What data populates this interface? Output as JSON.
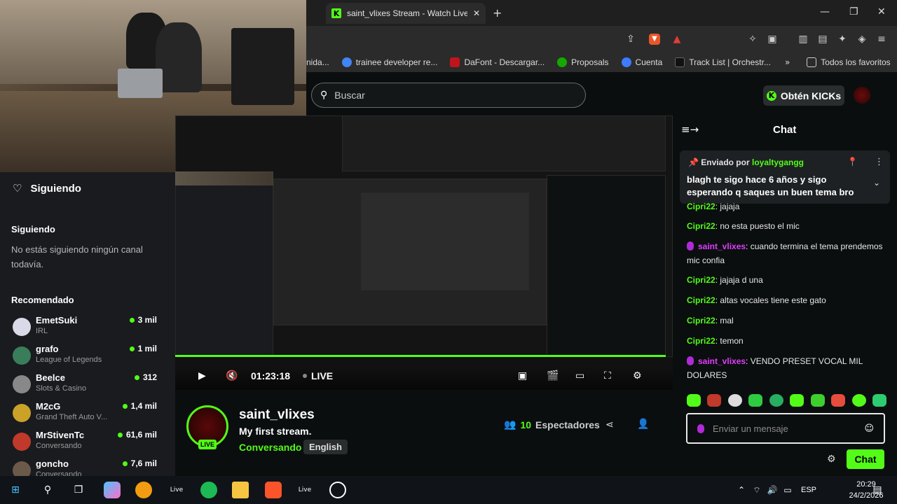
{
  "browser": {
    "tab_title": "saint_vlixes Stream - Watch Live",
    "bookmarks": [
      {
        "label": "nida...",
        "color": "#2b2b2b"
      },
      {
        "label": "trainee developer re...",
        "color": "#4285f4"
      },
      {
        "label": "DaFont - Descargar...",
        "color": "#c0141c"
      },
      {
        "label": "Proposals",
        "color": "#14a800"
      },
      {
        "label": "Cuenta",
        "color": "#3d7bff"
      },
      {
        "label": "Track List | Orchestr...",
        "color": "#111111"
      }
    ],
    "all_bookmarks": "Todos los favoritos"
  },
  "header": {
    "search_placeholder": "Buscar",
    "kicks_button": "Obtén KICKs"
  },
  "sidebar": {
    "following_title": "Siguiendo",
    "following_label": "Siguiendo",
    "empty_text": "No estás siguiendo ningún canal todavía.",
    "recommended_label": "Recomendado",
    "channels": [
      {
        "name": "EmetSuki",
        "category": "IRL",
        "viewers": "3 mil",
        "color": "#d9d9e8"
      },
      {
        "name": "grafo",
        "category": "League of Legends",
        "viewers": "1 mil",
        "color": "#3a7d5a"
      },
      {
        "name": "Beelce",
        "category": "Slots & Casino",
        "viewers": "312",
        "color": "#888888"
      },
      {
        "name": "M2cG",
        "category": "Grand Theft Auto V...",
        "viewers": "1,4 mil",
        "color": "#c9a227"
      },
      {
        "name": "MrStivenTc",
        "category": "Conversando",
        "viewers": "61,6 mil",
        "color": "#c0392b"
      },
      {
        "name": "goncho",
        "category": "Conversando",
        "viewers": "7,6 mil",
        "color": "#6b5a4a"
      }
    ]
  },
  "player": {
    "time": "01:23:18",
    "live_label": "LIVE"
  },
  "stream": {
    "streamer": "saint_vlixes",
    "title": "My first stream.",
    "category": "Conversando",
    "language": "English",
    "viewers": "10",
    "viewers_label": "Espectadores",
    "live_badge": "LIVE"
  },
  "chat": {
    "title": "Chat",
    "pinned_by_prefix": "Enviado por",
    "pinned_by_user": "loyaltygangg",
    "pinned_message": "blagh te sigo hace 6 años y sigo esperando q saques un buen tema bro",
    "messages": [
      {
        "user": "Cipri22",
        "text": "jajaja",
        "mod": false
      },
      {
        "user": "Cipri22",
        "text": "no esta puesto el mic",
        "mod": false
      },
      {
        "user": "saint_vlixes",
        "text": "cuando termina el tema prendemos mic confia",
        "mod": true
      },
      {
        "user": "Cipri22",
        "text": "jajaja d una",
        "mod": false
      },
      {
        "user": "Cipri22",
        "text": "altas vocales tiene este gato",
        "mod": false
      },
      {
        "user": "Cipri22",
        "text": "mal",
        "mod": false
      },
      {
        "user": "Cipri22",
        "text": "temon",
        "mod": false
      },
      {
        "user": "saint_vlixes",
        "text": "VENDO PRESET VOCAL MIL DOLARES",
        "mod": true
      }
    ],
    "input_placeholder": "Enviar un mensaje",
    "send_label": "Chat"
  },
  "taskbar": {
    "live_label_1": "Live",
    "live_label_2": "Live",
    "language": "ESP",
    "time": "20:29",
    "date": "24/2/2026"
  }
}
